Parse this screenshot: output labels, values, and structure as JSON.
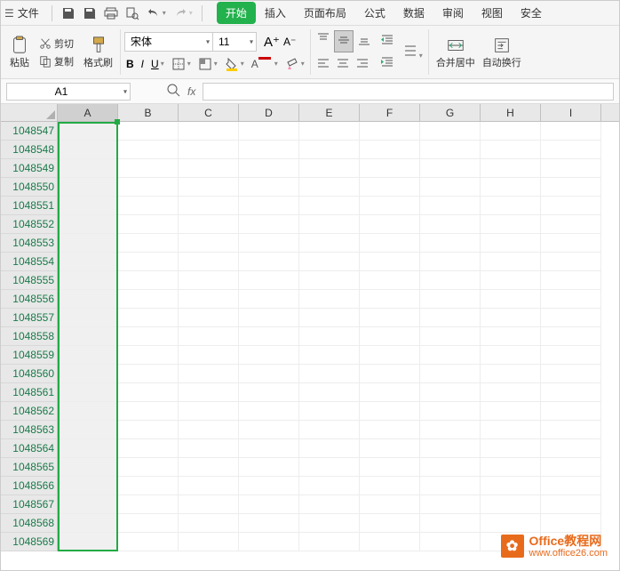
{
  "menubar": {
    "file_label": "文件",
    "tabs": [
      "开始",
      "插入",
      "页面布局",
      "公式",
      "数据",
      "审阅",
      "视图",
      "安全"
    ],
    "active_tab_index": 0
  },
  "ribbon": {
    "paste_label": "粘贴",
    "cut_label": "剪切",
    "copy_label": "复制",
    "painter_label": "格式刷",
    "font_name": "宋体",
    "font_size": "11",
    "merge_label": "合并居中",
    "wrap_label": "自动换行"
  },
  "namebox": {
    "value": "A1",
    "fx_label": "fx"
  },
  "grid": {
    "columns": [
      "A",
      "B",
      "C",
      "D",
      "E",
      "F",
      "G",
      "H",
      "I"
    ],
    "selected_column_index": 0,
    "row_start": 1048547,
    "row_count": 23
  },
  "watermark": {
    "title": "Office教程网",
    "url": "www.office26.com"
  }
}
